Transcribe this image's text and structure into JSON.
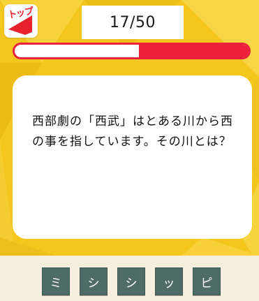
{
  "header": {
    "top_button_label": "トップ",
    "counter": "17/50"
  },
  "progress": {
    "filled_fraction": 0.47,
    "fill_color": "#f0203a"
  },
  "question": {
    "text": "西部劇の「西武」はとある川から西の事を指しています。その川とは？"
  },
  "answer_keys": [
    "ミ",
    "シ",
    "シ",
    "ッ",
    "ピ"
  ],
  "colors": {
    "background": "#f4c61e",
    "key": "#4e6b68",
    "accent": "#e8212f"
  }
}
